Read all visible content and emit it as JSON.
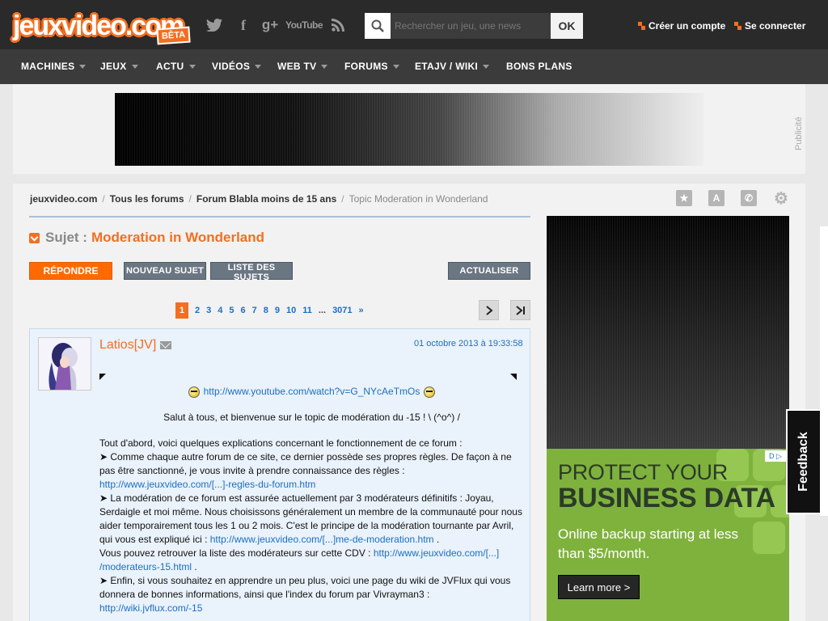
{
  "header": {
    "logo_text": "jeuxvideo.com",
    "logo_badge": "BÊTA",
    "social": {
      "twitter": "twitter-icon",
      "facebook": "f",
      "googleplus": "g+",
      "youtube": "YouTube",
      "rss": "rss-icon"
    },
    "search": {
      "placeholder": "Rechercher un jeu, une news",
      "button": "OK"
    },
    "create_account": "Créer un compte",
    "login": "Se connecter",
    "accent_color": "#f26f21"
  },
  "nav": {
    "items": [
      {
        "label": "MACHINES"
      },
      {
        "label": "JEUX"
      },
      {
        "label": "ACTU"
      },
      {
        "label": "VIDÉOS"
      },
      {
        "label": "WEB TV"
      },
      {
        "label": "FORUMS"
      },
      {
        "label": "ETAJV / WIKI"
      },
      {
        "label": "BONS PLANS"
      }
    ]
  },
  "ad_banner": {
    "label": "Publicité"
  },
  "breadcrumb": {
    "items": [
      "jeuxvideo.com",
      "Tous les forums",
      "Forum Blabla moins de 15 ans"
    ],
    "current": "Topic Moderation in Wonderland"
  },
  "topic": {
    "prefix": "Sujet :",
    "title": "Moderation in Wonderland"
  },
  "actions": {
    "reply": "RÉPONDRE",
    "new_topic": "NOUVEAU SUJET",
    "topic_list": "LISTE DES SUJETS",
    "refresh": "ACTUALISER"
  },
  "pager": {
    "current": "1",
    "pages": [
      "2",
      "3",
      "4",
      "5",
      "6",
      "7",
      "8",
      "9",
      "10",
      "11"
    ],
    "ellipsis": "...",
    "last": "3071",
    "next": "»"
  },
  "post": {
    "author": "Latios[JV]",
    "date": "01 octobre 2013 à 19:33:58",
    "youtube_link": "http://www.youtube.com/watch?v=G_NYcAeTmOs",
    "greeting": "Salut à tous, et bienvenue sur le topic de modération du -15 ! \\ (^o^) /",
    "intro": "Tout d'abord, voici quelques explications concernant le fonctionnement de ce forum :",
    "p1": "➤ Comme chaque autre forum de ce site, ce dernier possède ses propres règles. De façon à ne pas être sanctionné, je vous invite à prendre connaissance des règles :",
    "link1": "http://www.jeuxvideo.com/[...]-regles-du-forum.htm",
    "p2": "➤ La modération de ce forum est assurée actuellement par 3 modérateurs définitifs : Joyau, Serdaigle et moi même. Nous choisissons généralement un membre de la communauté pour nous aider temporairement tous les 1 ou 2 mois. C'est le principe de la modération tournante par Avril, qui vous est expliqué ici :",
    "link2": "http://www.jeuxvideo.com/[...]me-de-moderation.htm",
    "p3": "Vous pouvez retrouver la liste des modérateurs sur cette CDV :",
    "link3a": "http://www.jeuxvideo.com/[...]",
    "link3b": "/moderateurs-15.html",
    "p4": "➤ Enfin, si vous souhaitez en apprendre un peu plus, voici une page du wiki de JVFlux qui vous donnera de bonnes informations, ainsi que l'index du forum par Vivrayman3 :",
    "link4": "http://wiki.jvflux.com/-15",
    "dot": "."
  },
  "side_ad": {
    "title1": "PROTECT YOUR",
    "title2": "BUSINESS DATA",
    "sub": "Online backup starting at less than $5/month.",
    "button": "Learn more >",
    "adchoices": "D ▷"
  },
  "feedback": "Feedback"
}
